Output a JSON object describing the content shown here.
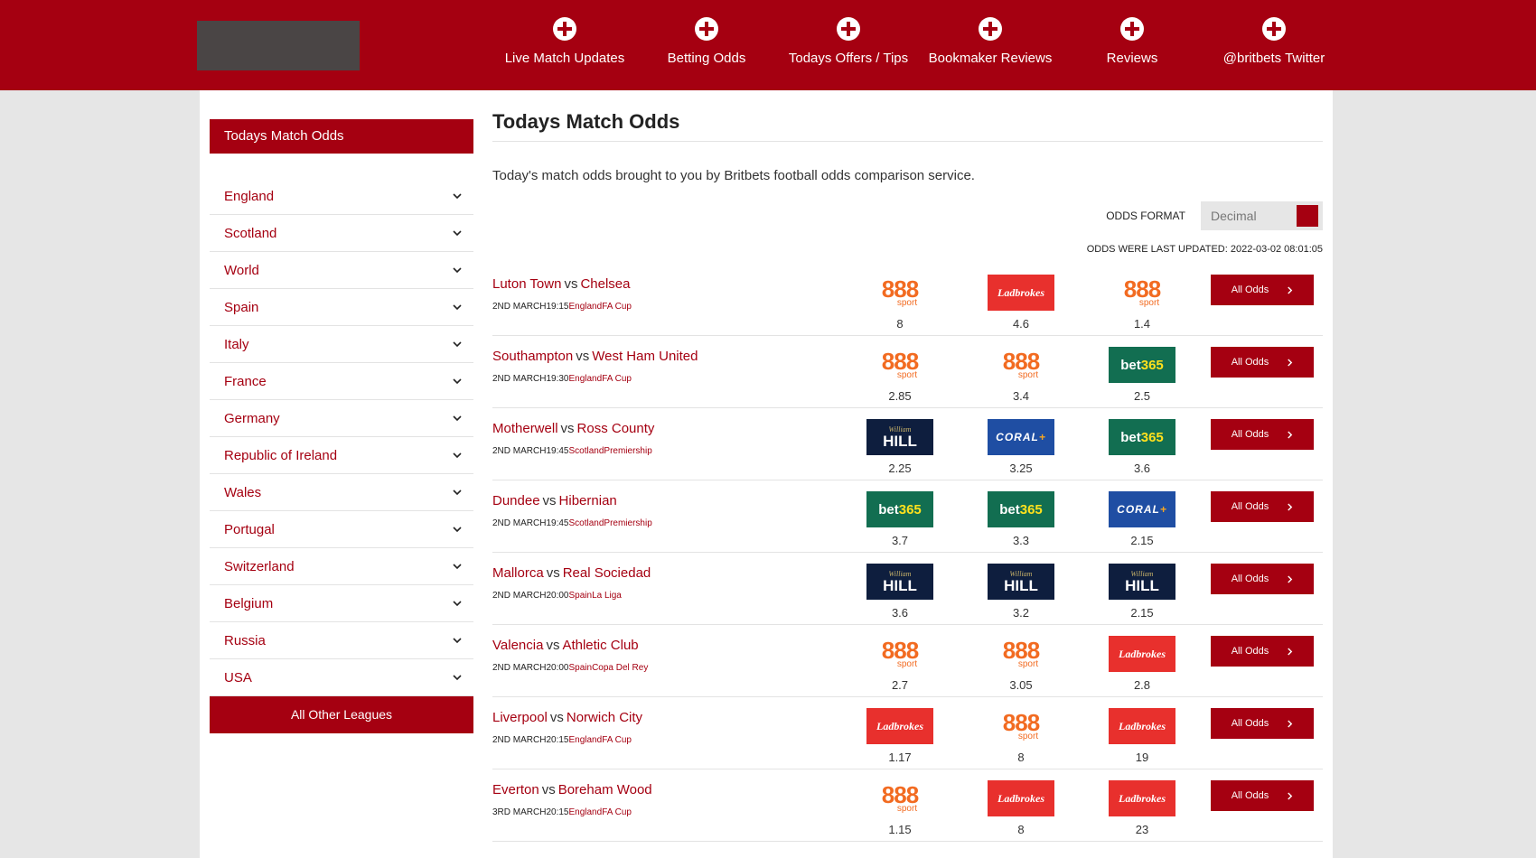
{
  "header": {
    "nav": [
      {
        "label": "Live Match Updates",
        "icon": "plus-circle-icon"
      },
      {
        "label": "Betting Odds",
        "icon": "plus-circle-icon"
      },
      {
        "label": "Todays Offers / Tips",
        "icon": "plus-circle-icon"
      },
      {
        "label": "Bookmaker Reviews",
        "icon": "plus-circle-icon"
      },
      {
        "label": "Reviews",
        "icon": "plus-circle-icon"
      },
      {
        "label": "@britbets Twitter",
        "icon": "plus-circle-icon"
      }
    ]
  },
  "sidebar": {
    "title": "Todays Match Odds",
    "items": [
      {
        "label": "England"
      },
      {
        "label": "Scotland"
      },
      {
        "label": "World"
      },
      {
        "label": "Spain"
      },
      {
        "label": "Italy"
      },
      {
        "label": "France"
      },
      {
        "label": "Germany"
      },
      {
        "label": "Republic of Ireland"
      },
      {
        "label": "Wales"
      },
      {
        "label": "Portugal"
      },
      {
        "label": "Switzerland"
      },
      {
        "label": "Belgium"
      },
      {
        "label": "Russia"
      },
      {
        "label": "USA"
      }
    ],
    "all_other": "All Other Leagues"
  },
  "main": {
    "title": "Todays Match Odds",
    "description": "Today's match odds brought to you by Britbets football odds comparison service.",
    "odds_format_label": "ODDS FORMAT",
    "odds_format_value": "Decimal",
    "updated": "ODDS WERE LAST UPDATED: 2022-03-02 08:01:05",
    "all_odds_label": "All Odds",
    "vs": "vs",
    "matches": [
      {
        "home": "Luton Town",
        "away": "Chelsea",
        "date": "2ND MARCH",
        "time": "19:15",
        "country": "England",
        "comp": "FA Cup",
        "odds": [
          {
            "bk": "888",
            "v": "8"
          },
          {
            "bk": "ladbrokes",
            "v": "4.6"
          },
          {
            "bk": "888",
            "v": "1.4"
          }
        ]
      },
      {
        "home": "Southampton",
        "away": "West Ham United",
        "date": "2ND MARCH",
        "time": "19:30",
        "country": "England",
        "comp": "FA Cup",
        "odds": [
          {
            "bk": "888",
            "v": "2.85"
          },
          {
            "bk": "888",
            "v": "3.4"
          },
          {
            "bk": "bet365",
            "v": "2.5"
          }
        ]
      },
      {
        "home": "Motherwell",
        "away": "Ross County",
        "date": "2ND MARCH",
        "time": "19:45",
        "country": "Scotland",
        "comp": "Premiership",
        "odds": [
          {
            "bk": "hill",
            "v": "2.25"
          },
          {
            "bk": "coral",
            "v": "3.25"
          },
          {
            "bk": "bet365",
            "v": "3.6"
          }
        ]
      },
      {
        "home": "Dundee",
        "away": "Hibernian",
        "date": "2ND MARCH",
        "time": "19:45",
        "country": "Scotland",
        "comp": "Premiership",
        "odds": [
          {
            "bk": "bet365",
            "v": "3.7"
          },
          {
            "bk": "bet365",
            "v": "3.3"
          },
          {
            "bk": "coral",
            "v": "2.15"
          }
        ]
      },
      {
        "home": "Mallorca",
        "away": "Real Sociedad",
        "date": "2ND MARCH",
        "time": "20:00",
        "country": "Spain",
        "comp": "La Liga",
        "odds": [
          {
            "bk": "hill",
            "v": "3.6"
          },
          {
            "bk": "hill",
            "v": "3.2"
          },
          {
            "bk": "hill",
            "v": "2.15"
          }
        ]
      },
      {
        "home": "Valencia",
        "away": "Athletic Club",
        "date": "2ND MARCH",
        "time": "20:00",
        "country": "Spain",
        "comp": "Copa Del Rey",
        "odds": [
          {
            "bk": "888",
            "v": "2.7"
          },
          {
            "bk": "888",
            "v": "3.05"
          },
          {
            "bk": "ladbrokes",
            "v": "2.8"
          }
        ]
      },
      {
        "home": "Liverpool",
        "away": "Norwich City",
        "date": "2ND MARCH",
        "time": "20:15",
        "country": "England",
        "comp": "FA Cup",
        "odds": [
          {
            "bk": "ladbrokes",
            "v": "1.17"
          },
          {
            "bk": "888",
            "v": "8"
          },
          {
            "bk": "ladbrokes",
            "v": "19"
          }
        ]
      },
      {
        "home": "Everton",
        "away": "Boreham Wood",
        "date": "3RD MARCH",
        "time": "20:15",
        "country": "England",
        "comp": "FA Cup",
        "odds": [
          {
            "bk": "888",
            "v": "1.15"
          },
          {
            "bk": "ladbrokes",
            "v": "8"
          },
          {
            "bk": "ladbrokes",
            "v": "23"
          }
        ]
      }
    ]
  },
  "bookmakers": {
    "888": {
      "main": "888",
      "sub": "sport"
    },
    "ladbrokes": {
      "main": "Ladbrokes"
    },
    "bet365": {
      "main": "bet",
      "accent": "365"
    },
    "hill": {
      "main": "HILL",
      "sub": "William"
    },
    "coral": {
      "main": "CORAL",
      "accent": "+"
    }
  },
  "colors": {
    "brand": "#a50011",
    "page_bg": "#e6e6e6"
  }
}
